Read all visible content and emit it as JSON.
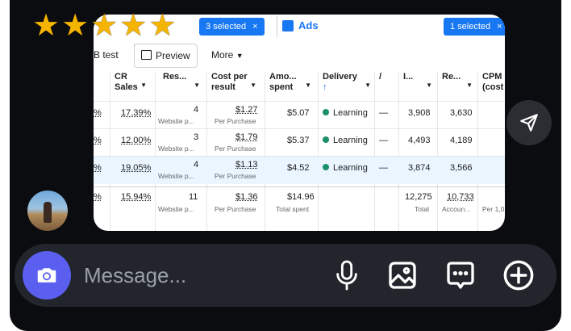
{
  "rating": {
    "stars": 5,
    "max": 5,
    "color": "#f5b400"
  },
  "preview_card": {
    "badges": {
      "left": "3 selected",
      "right": "1 selected",
      "close": "×"
    },
    "ads_label": "Ads",
    "toolbar": {
      "ab_test": "B test",
      "preview": "Preview",
      "more": "More"
    },
    "columns": [
      {
        "key": "cr",
        "label": "CR Sales"
      },
      {
        "key": "res",
        "label": "Res..."
      },
      {
        "key": "cpr",
        "label": "Cost per result"
      },
      {
        "key": "amt",
        "label": "Amo... spent"
      },
      {
        "key": "del",
        "label": "Delivery"
      },
      {
        "key": "slash",
        "label": "/"
      },
      {
        "key": "imp",
        "label": "I..."
      },
      {
        "key": "reach",
        "label": "Re..."
      },
      {
        "key": "cpm",
        "label": "CPM (cost"
      }
    ],
    "rows": [
      {
        "pct": "%",
        "cr": "17.39%",
        "res": "4",
        "res_sub": "Website p...",
        "cpr": "$1.27",
        "cpr_sub": "Per Purchase",
        "amt": "$5.07",
        "delivery": "Learning",
        "dash": "—",
        "imp": "3,908",
        "reach": "3,630",
        "selected": false
      },
      {
        "pct": "%",
        "cr": "12.00%",
        "res": "3",
        "res_sub": "Website p...",
        "cpr": "$1.79",
        "cpr_sub": "Per Purchase",
        "amt": "$5.37",
        "delivery": "Learning",
        "dash": "—",
        "imp": "4,493",
        "reach": "4,189",
        "selected": false
      },
      {
        "pct": "%",
        "cr": "19.05%",
        "res": "4",
        "res_sub": "Website p...",
        "cpr": "$1.13",
        "cpr_sub": "Per Purchase",
        "amt": "$4.52",
        "delivery": "Learning",
        "dash": "—",
        "imp": "3,874",
        "reach": "3,566",
        "selected": true
      }
    ],
    "total": {
      "pct": "%",
      "cr": "15.94%",
      "res": "11",
      "res_sub": "Website p...",
      "cpr": "$1.36",
      "cpr_sub": "Per Purchase",
      "amt": "$14.96",
      "amt_sub": "Total spent",
      "imp": "12,275",
      "imp_sub": "Total",
      "reach": "10,733",
      "reach_sub": "Accoun...",
      "cpm_sub": "Per 1,0"
    }
  },
  "composer": {
    "placeholder": "Message..."
  },
  "icons": {
    "send": "send-icon",
    "camera": "camera-icon",
    "mic": "microphone-icon",
    "gallery": "gallery-icon",
    "sticker": "chat-bubble-icon",
    "add": "plus-icon"
  },
  "colors": {
    "background": "#0b0c10",
    "accent": "#1877f2",
    "camera_button": "#5a5ff0",
    "learning_dot": "#1b8f6a"
  }
}
